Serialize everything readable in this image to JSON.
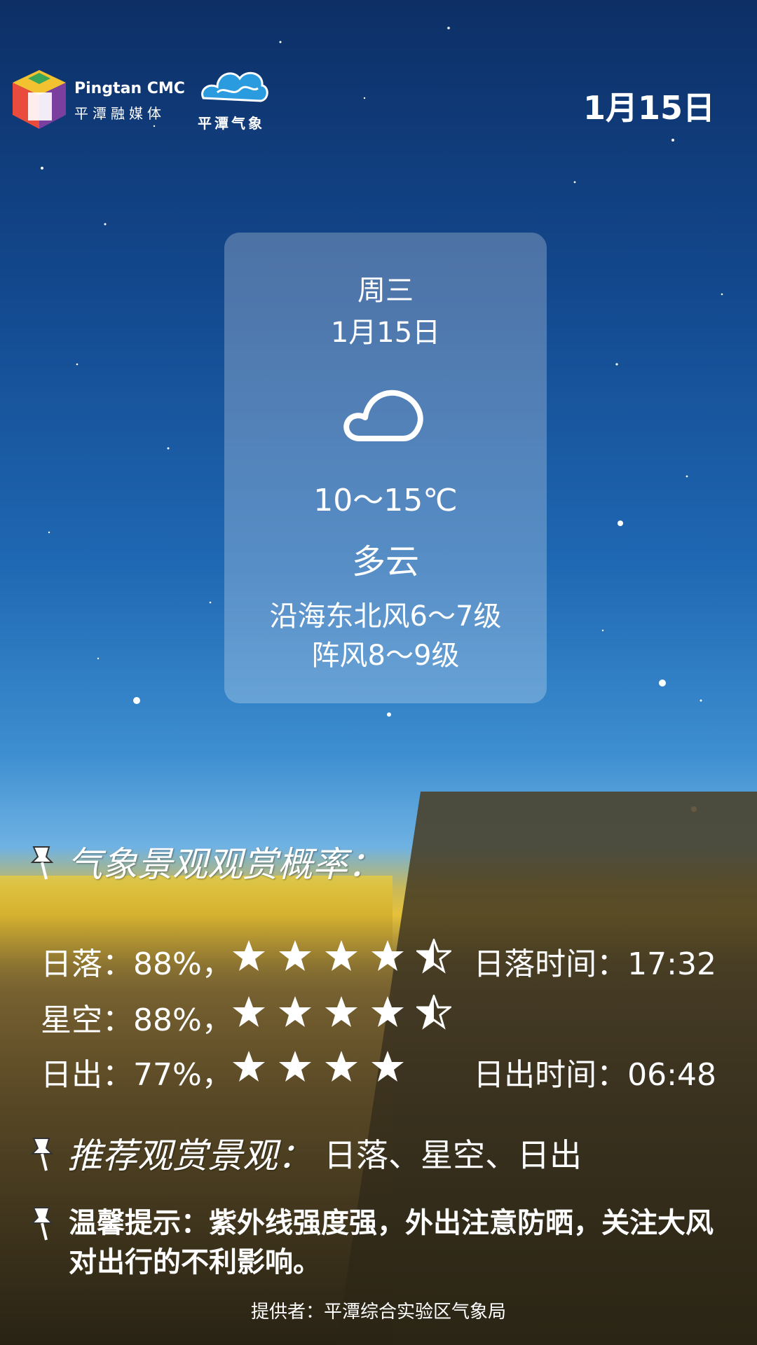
{
  "header": {
    "brand_en": "Pingtan CMC",
    "brand_cn": "平潭融媒体",
    "weather_brand": "平潭气象",
    "date": "1月15日"
  },
  "card": {
    "weekday": "周三",
    "date": "1月15日",
    "icon": "cloud-icon",
    "temperature": "10～15℃",
    "condition": "多云",
    "wind_line1": "沿海东北风6～7级",
    "wind_line2": "阵风8～9级"
  },
  "scenery": {
    "title": "气象景观观赏概率：",
    "rows": [
      {
        "label": "日落：88%，",
        "rating": 4.5,
        "time_label": "日落时间：17:32"
      },
      {
        "label": "星空：88%，",
        "rating": 4.5,
        "time_label": ""
      },
      {
        "label": "日出：77%，",
        "rating": 4,
        "time_label": "日出时间：06:48"
      }
    ]
  },
  "recommend": {
    "label": "推荐观赏景观：",
    "value": "日落、星空、日出"
  },
  "tip": {
    "text": "温馨提示：紫外线强度强，外出注意防晒，关注大风对出行的不利影响。"
  },
  "footer": {
    "text": "提供者：平潭综合实验区气象局"
  }
}
